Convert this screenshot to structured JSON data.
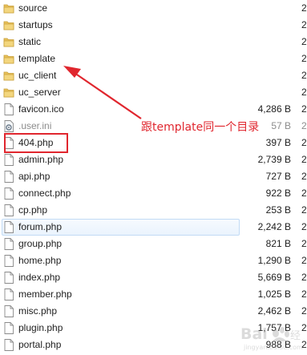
{
  "files": [
    {
      "name": "source",
      "type": "folder",
      "size": "",
      "trunc": "2"
    },
    {
      "name": "startups",
      "type": "folder",
      "size": "",
      "trunc": "2"
    },
    {
      "name": "static",
      "type": "folder",
      "size": "",
      "trunc": "2"
    },
    {
      "name": "template",
      "type": "folder",
      "size": "",
      "trunc": "2"
    },
    {
      "name": "uc_client",
      "type": "folder",
      "size": "",
      "trunc": "2"
    },
    {
      "name": "uc_server",
      "type": "folder",
      "size": "",
      "trunc": "2"
    },
    {
      "name": "favicon.ico",
      "type": "file",
      "size": "4,286 B",
      "trunc": "2"
    },
    {
      "name": ".user.ini",
      "type": "settings-file",
      "size": "57 B",
      "trunc": "2",
      "hidden": true
    },
    {
      "name": "404.php",
      "type": "file",
      "size": "397 B",
      "trunc": "2"
    },
    {
      "name": "admin.php",
      "type": "file",
      "size": "2,739 B",
      "trunc": "2"
    },
    {
      "name": "api.php",
      "type": "file",
      "size": "727 B",
      "trunc": "2"
    },
    {
      "name": "connect.php",
      "type": "file",
      "size": "922 B",
      "trunc": "2"
    },
    {
      "name": "cp.php",
      "type": "file",
      "size": "253 B",
      "trunc": "2"
    },
    {
      "name": "forum.php",
      "type": "file",
      "size": "2,242 B",
      "trunc": "2",
      "hovered": true
    },
    {
      "name": "group.php",
      "type": "file",
      "size": "821 B",
      "trunc": "2"
    },
    {
      "name": "home.php",
      "type": "file",
      "size": "1,290 B",
      "trunc": "2"
    },
    {
      "name": "index.php",
      "type": "file",
      "size": "5,669 B",
      "trunc": "2"
    },
    {
      "name": "member.php",
      "type": "file",
      "size": "1,025 B",
      "trunc": "2"
    },
    {
      "name": "misc.php",
      "type": "file",
      "size": "2,462 B",
      "trunc": "2"
    },
    {
      "name": "plugin.php",
      "type": "file",
      "size": "1,757 B",
      "trunc": "2"
    },
    {
      "name": "portal.php",
      "type": "file",
      "size": "988 B",
      "trunc": "2"
    }
  ],
  "annotation": {
    "text": "跟template同一个目录",
    "color": "#e0262e"
  },
  "colors": {
    "folder": "#e8c15a",
    "hover_border": "#c2dbf5",
    "hidden_text": "#8c8c8c"
  },
  "watermark": {
    "text": "Bai 经验",
    "sub": "jingyan.baidu.com"
  }
}
